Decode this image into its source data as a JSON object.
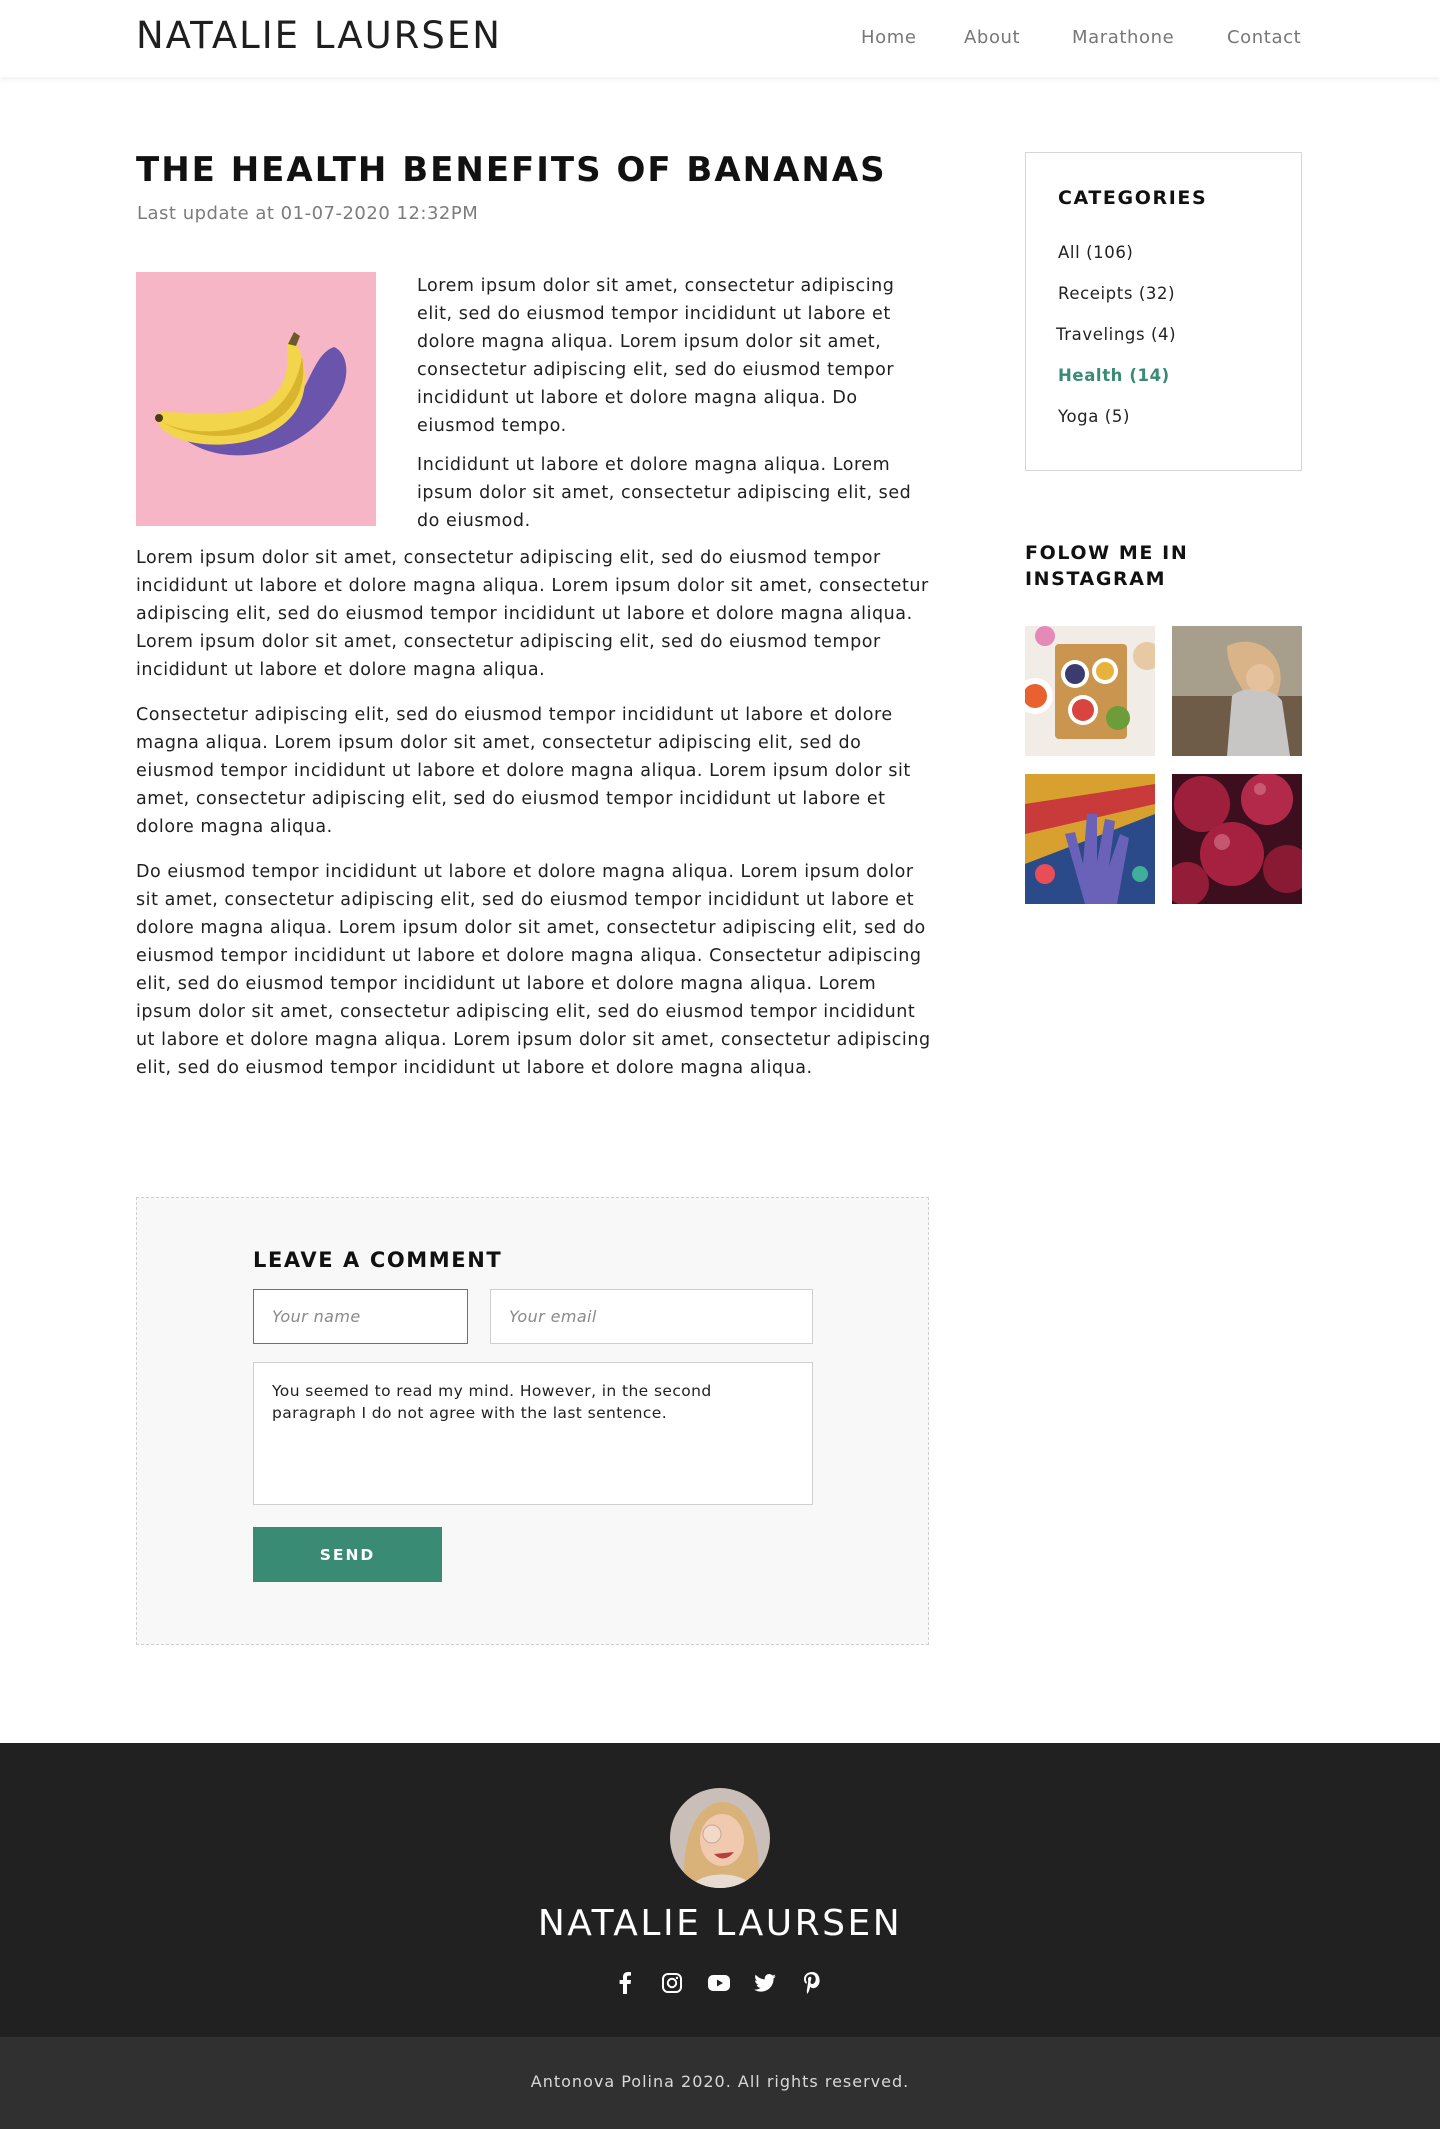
{
  "header": {
    "logo": "NATALIE LAURSEN",
    "nav": [
      "Home",
      "About",
      "Marathone",
      "Contact"
    ]
  },
  "post": {
    "title": "THE HEALTH BENEFITS OF BANANAS",
    "date": "Last update at 01-07-2020 12:32PM",
    "paragraphs": [
      "Lorem ipsum dolor sit amet, consectetur adipiscing elit, sed do eiusmod tempor incididunt ut labore et dolore magna aliqua. Lorem ipsum dolor sit amet, consectetur adipiscing elit, sed do eiusmod tempor incididunt ut labore et dolore magna aliqua. Do eiusmod tempo.",
      "Incididunt ut labore et dolore magna aliqua. Lorem ipsum dolor sit amet, consectetur adipiscing elit, sed do eiusmod.",
      "Lorem ipsum dolor sit amet, consectetur adipiscing elit, sed do eiusmod tempor incididunt ut labore et dolore magna aliqua. Lorem ipsum dolor sit amet, consectetur adipiscing elit, sed do eiusmod tempor incididunt ut labore et dolore magna aliqua. Lorem ipsum dolor sit amet, consectetur adipiscing elit, sed do eiusmod tempor incididunt ut labore et dolore magna aliqua.",
      "Consectetur adipiscing elit, sed do eiusmod tempor incididunt ut labore et dolore magna aliqua. Lorem ipsum dolor sit amet, consectetur adipiscing elit, sed do eiusmod tempor incididunt ut labore et dolore magna aliqua. Lorem ipsum dolor sit amet, consectetur adipiscing elit, sed do eiusmod tempor incididunt ut labore et dolore magna aliqua.",
      "Do eiusmod tempor incididunt ut labore et dolore magna aliqua. Lorem ipsum dolor sit amet, consectetur adipiscing elit, sed do eiusmod tempor incididunt ut labore et dolore magna aliqua. Lorem ipsum dolor sit amet, consectetur adipiscing elit, sed do eiusmod tempor incididunt ut labore et dolore magna aliqua. Consectetur adipiscing elit, sed do eiusmod tempor incididunt ut labore et dolore magna aliqua. Lorem ipsum dolor sit amet, consectetur adipiscing elit, sed do eiusmod tempor incididunt ut labore et dolore magna aliqua. Lorem ipsum dolor sit amet, consectetur adipiscing elit, sed do eiusmod tempor incididunt ut labore et dolore magna aliqua."
    ]
  },
  "sidebar": {
    "categories_title": "CATEGORIES",
    "categories": [
      {
        "label": "All (106)"
      },
      {
        "label": "Receipts (32)"
      },
      {
        "label": "Travelings (4)"
      },
      {
        "label": "Health (14)",
        "active": true
      },
      {
        "label": "Yoga (5)"
      }
    ],
    "instagram_title": "FOLOW ME IN INSTAGRAM"
  },
  "comment": {
    "title": "LEAVE A COMMENT",
    "name_placeholder": "Your name",
    "email_placeholder": "Your email",
    "message_value": "You seemed to read my mind. However, in the second paragraph I do not agree with the last sentence.",
    "send_label": "SEND"
  },
  "footer": {
    "name": "NATALIE LAURSEN",
    "social_icons": [
      "facebook-icon",
      "instagram-icon",
      "youtube-icon",
      "twitter-icon",
      "pinterest-icon"
    ],
    "copyright": "Antonova Polina 2020. All rights reserved."
  },
  "colors": {
    "accent": "#3a8b73",
    "footer_bg": "#212121",
    "bottom_bar_bg": "#303030"
  }
}
